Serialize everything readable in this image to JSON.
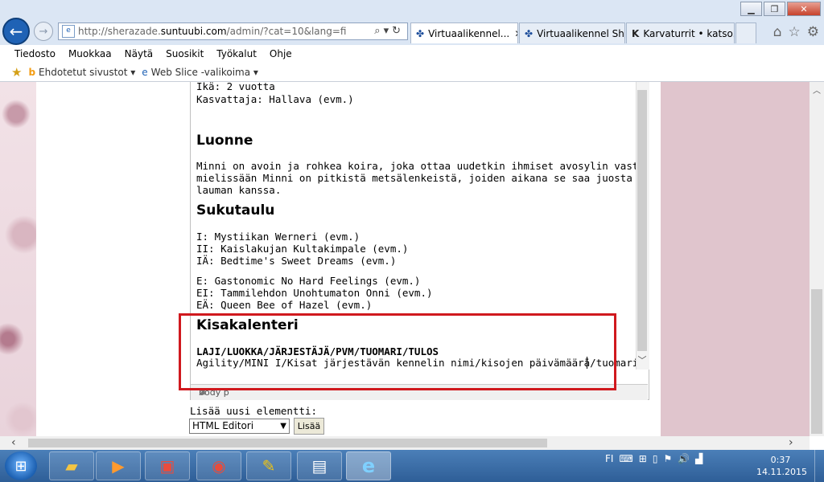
{
  "browser": {
    "address": {
      "prefix": "http://sherazade.",
      "domain": "suntuubi.com",
      "suffix": "/admin/?cat=10&lang=fi"
    },
    "tabs": [
      {
        "label": "Virtuaalikennel...",
        "icon": "turtle-icon"
      },
      {
        "label": "Virtuaalikennel Sh...",
        "icon": "turtle-icon"
      },
      {
        "label": "Karvaturrit • katso...",
        "icon": "k-icon"
      }
    ],
    "menu": [
      "Tiedosto",
      "Muokkaa",
      "Näytä",
      "Suosikit",
      "Työkalut",
      "Ohje"
    ],
    "favorites": {
      "suggested": "Ehdotetut sivustot",
      "webslice": "Web Slice -valikoima"
    }
  },
  "editor": {
    "lines_top": [
      "Ikä: 2 vuotta",
      "Kasvattaja: Hallava (evm.)"
    ],
    "luonne_heading": "Luonne",
    "luonne_text": [
      "Minni on avoin ja rohkea koira, joka ottaa uudetkin ihmiset avosylin vastaan. Erityisen",
      "mielissään Minni on pitkistä metsälenkeistä, joiden aikana se saa juosta vapaana muun",
      "lauman kanssa."
    ],
    "sukutaulu_heading": "Sukutaulu",
    "sire_line": [
      "I: Mystiikan Werneri (evm.)",
      "II: Kaislakujan Kultakimpale (evm.)",
      "IÄ: Bedtime's Sweet Dreams (evm.)"
    ],
    "dam_line": [
      "E: Gastonomic No Hard Feelings (evm.)",
      "EI: Tammilehdon Unohtumaton Onni (evm.)",
      "EÄ: Queen Bee of Hazel (evm.)"
    ],
    "kisa_heading": "Kisakalenteri",
    "kisa_header": "LAJI/LUOKKA/JÄRJESTÄJÄ/PVM/TUOMARI/TULOS",
    "kisa_row": "Agility/MINI I/Kisat järjestävän kennelin nimi/kisojen päivämäärä/tuomari/tulos",
    "status": "body p"
  },
  "add_element": {
    "label": "Lisää uusi elementti:",
    "select_value": "HTML Editori",
    "button": "Lisää"
  },
  "taskbar": {
    "lang": "FI",
    "time": "0:37",
    "date": "14.11.2015"
  }
}
